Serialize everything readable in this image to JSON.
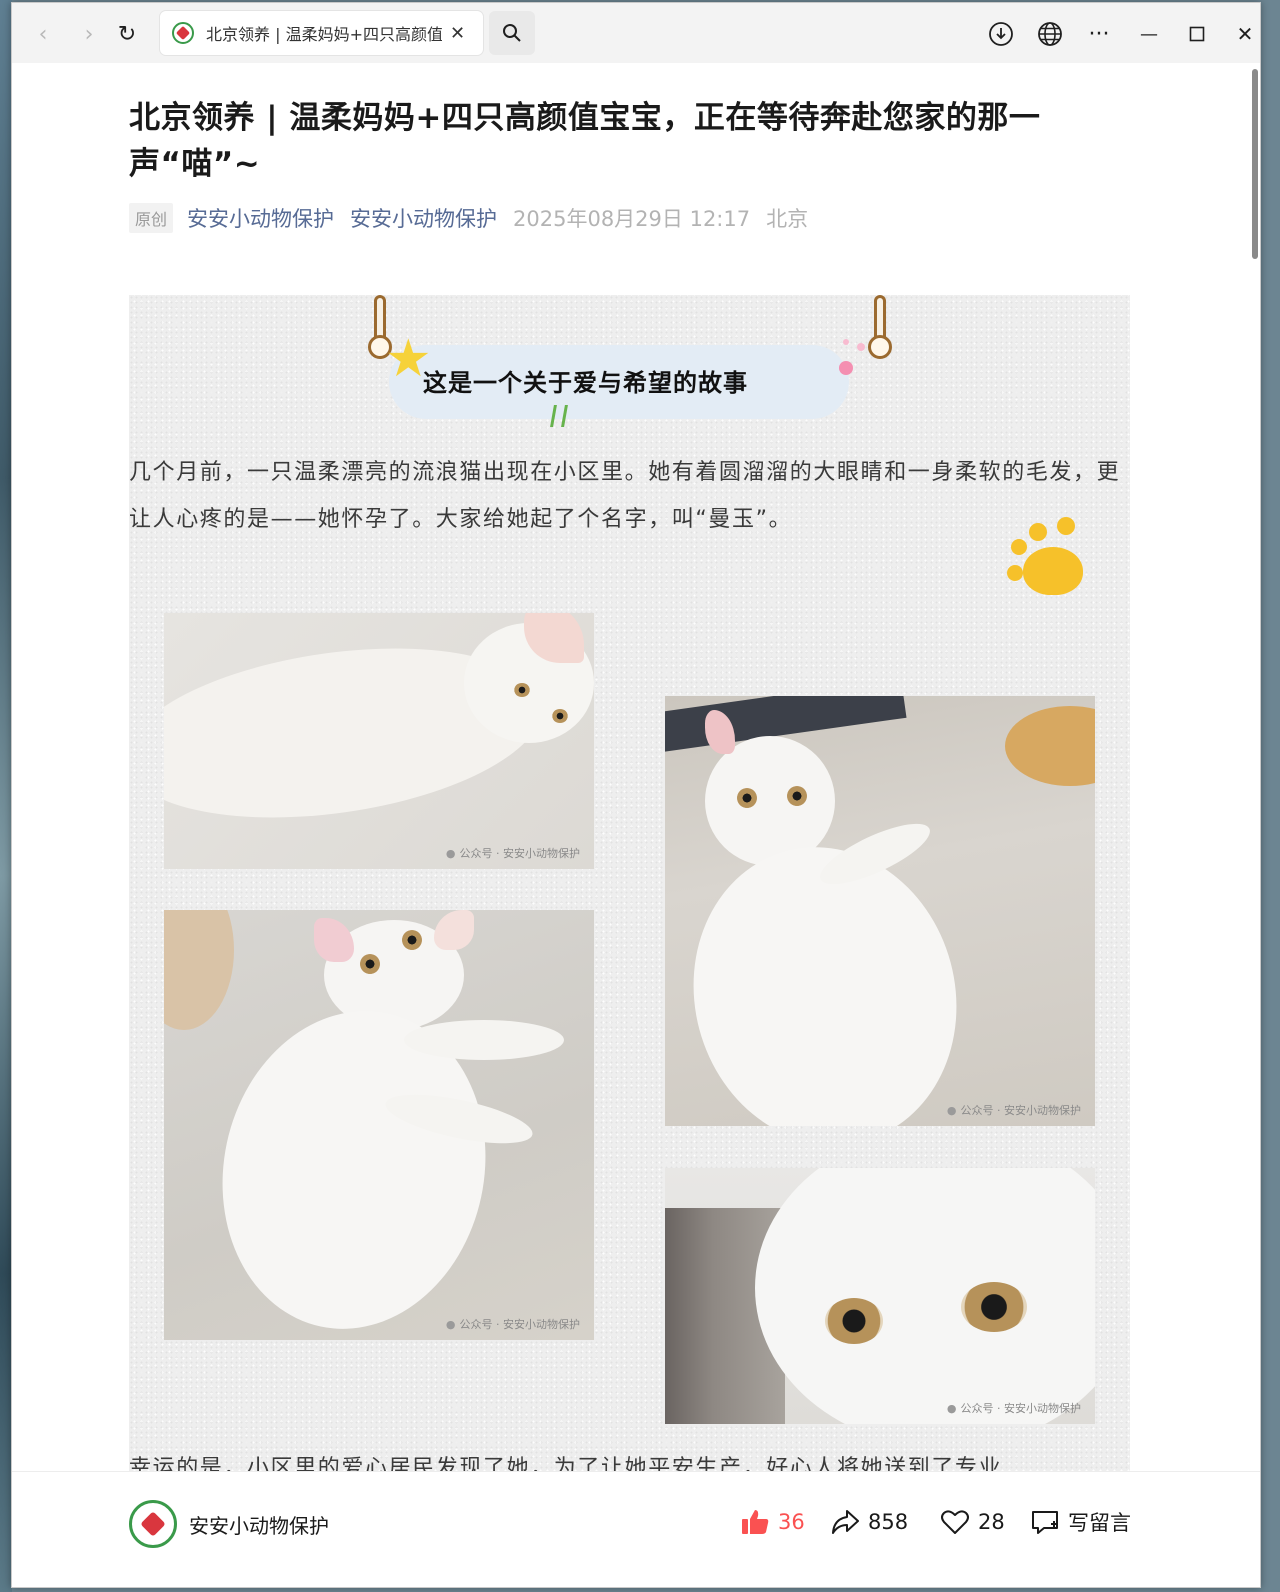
{
  "browser": {
    "tab_title": "北京领养 | 温柔妈妈+四只高颜值宝宝，正在等待奔赴您家的那一声“喵”~",
    "icons": [
      "back-icon",
      "forward-icon",
      "reload-icon",
      "search-icon",
      "download-icon",
      "globe-icon",
      "more-icon",
      "minimize-icon",
      "maximize-icon",
      "close-icon"
    ],
    "glyphs": {
      "back": "‹",
      "forward": "›",
      "reload": "↻",
      "close": "✕",
      "search": "⌕",
      "download": "⤓",
      "globe": "🌐",
      "more": "···",
      "minimize": "—",
      "maximize": "☐",
      "window_close": "✕"
    }
  },
  "article": {
    "title": "北京领养 | 温柔妈妈+四只高颜值宝宝，正在等待奔赴您家的那一声“喵”~",
    "badge": "原创",
    "author": "安安小动物保护",
    "account": "安安小动物保护",
    "date": "2025年08月29日 12:17",
    "location": "北京",
    "headline": "这是一个关于爱与希望的故事",
    "paragraph1": "几个月前，一只温柔漂亮的流浪猫出现在小区里。她有着圆溜溜的大眼睛和一身柔软的毛发，更让人心疼的是——她怀孕了。大家给她起了个名字，叫“曼玉”。",
    "paragraph2_cutoff": "幸运的是，小区里的爱心居民发现了她，为了让她平安生产，好心人将她送到了专业",
    "watermark": "公众号 · 安安小动物保护",
    "photos": [
      {
        "name": "cat-photo-lying",
        "watermark": true
      },
      {
        "name": "cat-photo-looking-up",
        "watermark": true
      },
      {
        "name": "cat-photo-sitting",
        "watermark": true
      },
      {
        "name": "cat-photo-closeup",
        "watermark": true
      }
    ]
  },
  "footer": {
    "account_name": "安安小动物保护",
    "like_count": "36",
    "share_count": "858",
    "favorite_count": "28",
    "comment_label": "写留言",
    "colors": {
      "like": "#fa5151",
      "text": "#1a1a1a"
    }
  },
  "colors": {
    "link": "#576b95",
    "muted": "#b3b3b3",
    "paw": "#f6c12a",
    "star": "#f6d23a"
  }
}
